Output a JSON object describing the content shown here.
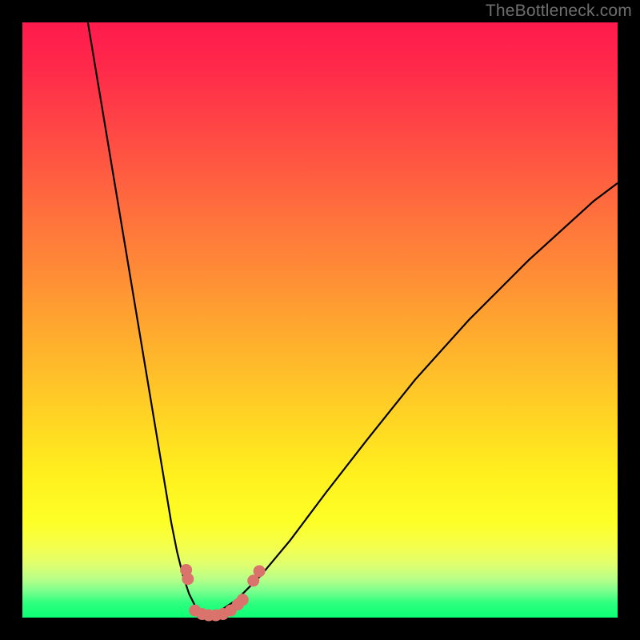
{
  "watermark": "TheBottleneck.com",
  "colors": {
    "background": "#000000",
    "curve": "#000000",
    "marker": "#d9736b",
    "gradient_top": "#ff1a4d",
    "gradient_bottom": "#0cff76"
  },
  "chart_data": {
    "type": "line",
    "title": "",
    "xlabel": "",
    "ylabel": "",
    "xlim": [
      0,
      100
    ],
    "ylim": [
      0,
      100
    ],
    "series": [
      {
        "name": "left-curve",
        "x": [
          11,
          13,
          15,
          17,
          19,
          21,
          23,
          24,
          25,
          26,
          27,
          28,
          29,
          30,
          31
        ],
        "y": [
          100,
          88,
          76,
          64,
          52,
          40,
          28,
          22,
          16,
          11,
          7,
          4,
          2,
          1,
          0
        ]
      },
      {
        "name": "right-curve",
        "x": [
          31,
          33,
          36,
          40,
          45,
          51,
          58,
          66,
          75,
          85,
          96,
          100
        ],
        "y": [
          0,
          1,
          3,
          7,
          13,
          21,
          30,
          40,
          50,
          60,
          70,
          73
        ]
      }
    ],
    "markers": {
      "name": "bottom-dots",
      "color": "#d9736b",
      "points": [
        {
          "x": 27.5,
          "y": 8.0,
          "r": 1.0
        },
        {
          "x": 27.8,
          "y": 6.5,
          "r": 1.0
        },
        {
          "x": 29.0,
          "y": 1.2,
          "r": 1.0
        },
        {
          "x": 30.2,
          "y": 0.6,
          "r": 1.0
        },
        {
          "x": 31.3,
          "y": 0.4,
          "r": 1.0
        },
        {
          "x": 32.5,
          "y": 0.4,
          "r": 1.0
        },
        {
          "x": 33.7,
          "y": 0.6,
          "r": 1.0
        },
        {
          "x": 35.0,
          "y": 1.2,
          "r": 1.0
        },
        {
          "x": 36.2,
          "y": 2.2,
          "r": 1.0
        },
        {
          "x": 37.0,
          "y": 3.0,
          "r": 1.0
        },
        {
          "x": 38.8,
          "y": 6.2,
          "r": 1.0
        },
        {
          "x": 39.8,
          "y": 7.8,
          "r": 1.0
        }
      ]
    }
  }
}
